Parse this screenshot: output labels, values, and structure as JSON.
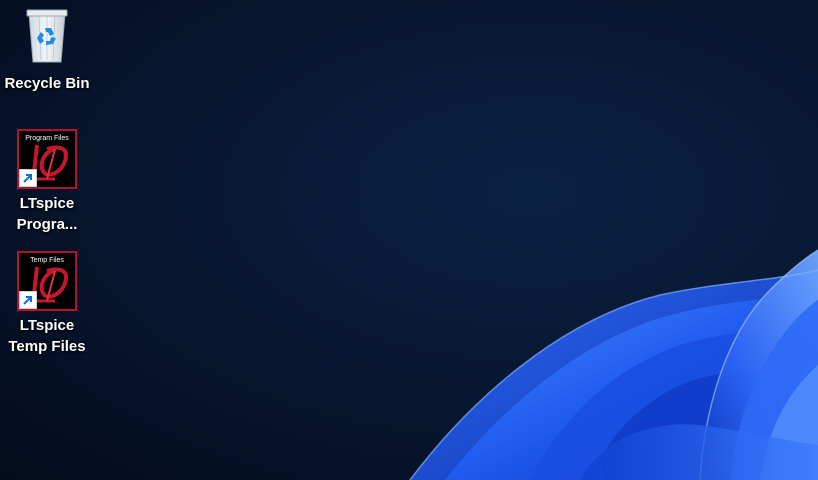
{
  "desktop": {
    "icons": [
      {
        "label": "Recycle Bin",
        "icon": "recycle-bin-icon"
      },
      {
        "label": "LTspice\nProgra...",
        "caption": "Program Files",
        "icon": "ltspice-logo-icon"
      },
      {
        "label": "LTspice\nTemp Files",
        "caption": "Temp Files",
        "icon": "ltspice-logo-icon"
      }
    ]
  },
  "colors": {
    "background": "#06132a",
    "bloom_light": "#3b7bff",
    "bloom_dark": "#0b2fa8",
    "ltspice_border": "#b3122a",
    "ltspice_red": "#c4172c"
  }
}
